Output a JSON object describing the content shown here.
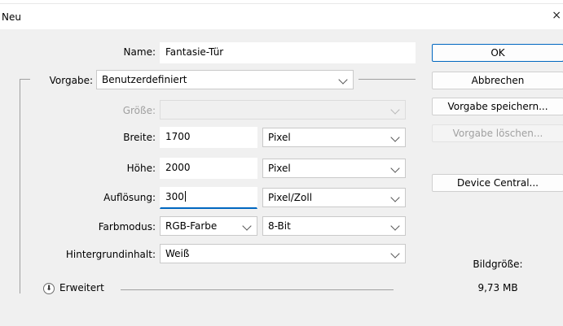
{
  "window": {
    "title": "Neu",
    "close_glyph": "×"
  },
  "form": {
    "name_label": "Name:",
    "name_value": "Fantasie-Tür",
    "preset_label": "Vorgabe:",
    "preset_value": "Benutzerdefiniert",
    "size_label": "Größe:",
    "size_value": "",
    "width_label": "Breite:",
    "width_value": "1700",
    "width_unit": "Pixel",
    "height_label": "Höhe:",
    "height_value": "2000",
    "height_unit": "Pixel",
    "resolution_label": "Auflösung:",
    "resolution_value": "300",
    "resolution_unit": "Pixel/Zoll",
    "colormode_label": "Farbmodus:",
    "colormode_value": "RGB-Farbe",
    "bitdepth_value": "8-Bit",
    "background_label": "Hintergrundinhalt:",
    "background_value": "Weiß",
    "advanced_label": "Erweitert"
  },
  "buttons": {
    "ok": "OK",
    "cancel": "Abbrechen",
    "save_preset": "Vorgabe speichern...",
    "delete_preset": "Vorgabe löschen...",
    "device_central": "Device Central..."
  },
  "image_size": {
    "label": "Bildgröße:",
    "value": "9,73 MB"
  },
  "colors": {
    "accent": "#0067c0",
    "background": "#f0f0f0",
    "disabled_text": "#a0a0a0"
  },
  "icons": [
    "close-icon",
    "chevron-down-icon",
    "expand-icon"
  ]
}
